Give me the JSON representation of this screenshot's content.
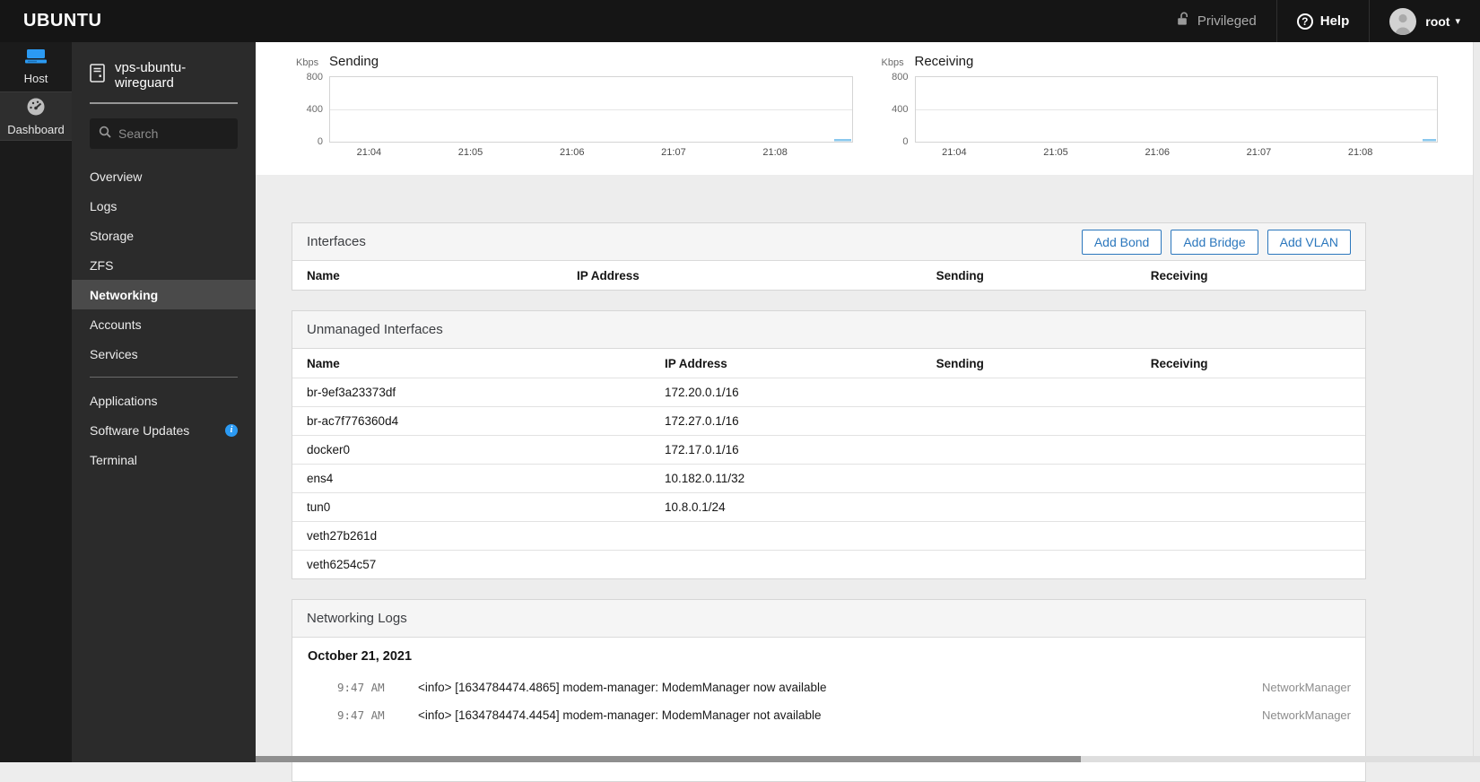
{
  "topbar": {
    "brand": "UBUNTU",
    "privileged_label": "Privileged",
    "help_label": "Help",
    "user": "root"
  },
  "icons": {
    "help_glyph": "?",
    "caret_glyph": "▾",
    "info_glyph": "i"
  },
  "nav_rail": {
    "host_label": "Host",
    "dashboard_label": "Dashboard"
  },
  "sidebar": {
    "host_name": "vps-ubuntu-wireguard",
    "search_placeholder": "Search",
    "menu": [
      {
        "label": "Overview"
      },
      {
        "label": "Logs"
      },
      {
        "label": "Storage"
      },
      {
        "label": "ZFS"
      },
      {
        "label": "Networking",
        "selected": true
      },
      {
        "label": "Accounts"
      },
      {
        "label": "Services"
      },
      {
        "label": "Applications"
      },
      {
        "label": "Software Updates",
        "badge": "info"
      },
      {
        "label": "Terminal"
      }
    ]
  },
  "charts": {
    "unit": "Kbps",
    "y_ticks": [
      "800",
      "400",
      "0"
    ],
    "x_ticks": [
      "21:04",
      "21:05",
      "21:06",
      "21:07",
      "21:08"
    ],
    "sending_title": "Sending",
    "receiving_title": "Receiving"
  },
  "chart_data": [
    {
      "type": "area",
      "title": "Sending",
      "ylabel": "Kbps",
      "ylim": [
        0,
        800
      ],
      "x": [
        "21:04",
        "21:05",
        "21:06",
        "21:07",
        "21:08"
      ],
      "values": [
        0,
        0,
        0,
        0,
        0
      ],
      "annotation": "small ~20 Kbps spike at right edge (≈21:08.5)",
      "grid": "horizontal at 400"
    },
    {
      "type": "area",
      "title": "Receiving",
      "ylabel": "Kbps",
      "ylim": [
        0,
        800
      ],
      "x": [
        "21:04",
        "21:05",
        "21:06",
        "21:07",
        "21:08"
      ],
      "values": [
        0,
        0,
        0,
        0,
        0
      ],
      "annotation": "small ~15 Kbps spike at right edge (≈21:08.5)",
      "grid": "horizontal at 400"
    }
  ],
  "interfaces": {
    "title": "Interfaces",
    "buttons": [
      "Add Bond",
      "Add Bridge",
      "Add VLAN"
    ],
    "columns": [
      "Name",
      "IP Address",
      "Sending",
      "Receiving"
    ],
    "rows": []
  },
  "unmanaged": {
    "title": "Unmanaged Interfaces",
    "columns": [
      "Name",
      "IP Address",
      "Sending",
      "Receiving"
    ],
    "rows": [
      {
        "name": "br-9ef3a23373df",
        "ip": "172.20.0.1/16"
      },
      {
        "name": "br-ac7f776360d4",
        "ip": "172.27.0.1/16"
      },
      {
        "name": "docker0",
        "ip": "172.17.0.1/16"
      },
      {
        "name": "ens4",
        "ip": "10.182.0.11/32"
      },
      {
        "name": "tun0",
        "ip": "10.8.0.1/24"
      },
      {
        "name": "veth27b261d",
        "ip": ""
      },
      {
        "name": "veth6254c57",
        "ip": ""
      }
    ]
  },
  "logs": {
    "title": "Networking Logs",
    "date": "October 21, 2021",
    "entries": [
      {
        "time": "9:47 AM",
        "message": "<info> [1634784474.4865] modem-manager: ModemManager now available",
        "source": "NetworkManager"
      },
      {
        "time": "9:47 AM",
        "message": "<info> [1634784474.4454] modem-manager: ModemManager not available",
        "source": "NetworkManager"
      }
    ]
  },
  "colors": {
    "accent_blue": "#2b77bd",
    "info_blue": "#2b9af3",
    "chart_fill": "#c9e5f5",
    "chart_stroke": "#89c8ee",
    "masthead_bg": "#151515",
    "sidebar_bg": "#2b2b2b",
    "selected_item_bg": "#4a4a4a"
  }
}
